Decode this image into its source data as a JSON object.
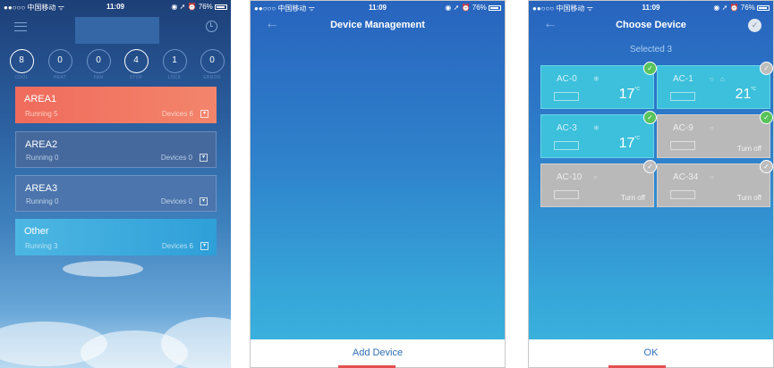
{
  "status": {
    "carrier": "●●○○○ 中国移动 ᯤ",
    "time": "11:09",
    "battery": "76%",
    "right_icons": "◉ ➚ ⏰"
  },
  "screen1": {
    "counters": [
      {
        "value": "8",
        "label": "COOL"
      },
      {
        "value": "0",
        "label": "HEAT"
      },
      {
        "value": "0",
        "label": "FAN"
      },
      {
        "value": "4",
        "label": "STOP"
      },
      {
        "value": "1",
        "label": "LOCK"
      },
      {
        "value": "0",
        "label": "ERROR"
      }
    ],
    "areas": [
      {
        "name": "AREA1",
        "running": "Running 5",
        "devices": "Devices 6"
      },
      {
        "name": "AREA2",
        "running": "Running 0",
        "devices": "Devices 0"
      },
      {
        "name": "AREA3",
        "running": "Running 0",
        "devices": "Devices 0"
      },
      {
        "name": "Other",
        "running": "Running 3",
        "devices": "Devices 6"
      }
    ]
  },
  "screen2": {
    "title": "Device Management",
    "back": "←",
    "bottom_label": "Add Device"
  },
  "screen3": {
    "title": "Choose Device",
    "back": "←",
    "check": "✓",
    "selected": "Selected 3",
    "devices": [
      {
        "name": "AC-0",
        "temp": "17",
        "unit": "°C",
        "state": "on",
        "selected": true
      },
      {
        "name": "AC-1",
        "temp": "21",
        "unit": "°C",
        "state": "on",
        "selected": false
      },
      {
        "name": "AC-3",
        "temp": "17",
        "unit": "°C",
        "state": "on",
        "selected": true
      },
      {
        "name": "AC-9",
        "status": "Turn off",
        "state": "off",
        "selected": true
      },
      {
        "name": "AC-10",
        "status": "Turn off",
        "state": "off",
        "selected": false
      },
      {
        "name": "AC-34",
        "status": "Turn off",
        "state": "off",
        "selected": false
      }
    ],
    "bottom_label": "OK"
  },
  "colors": {
    "area1": "#f06b5c",
    "other": "#4db7e3",
    "tile_on": "#3cc0dc",
    "tile_off": "#b9b9b9",
    "check_green": "#57c35a",
    "accent_line": "#e35050"
  }
}
